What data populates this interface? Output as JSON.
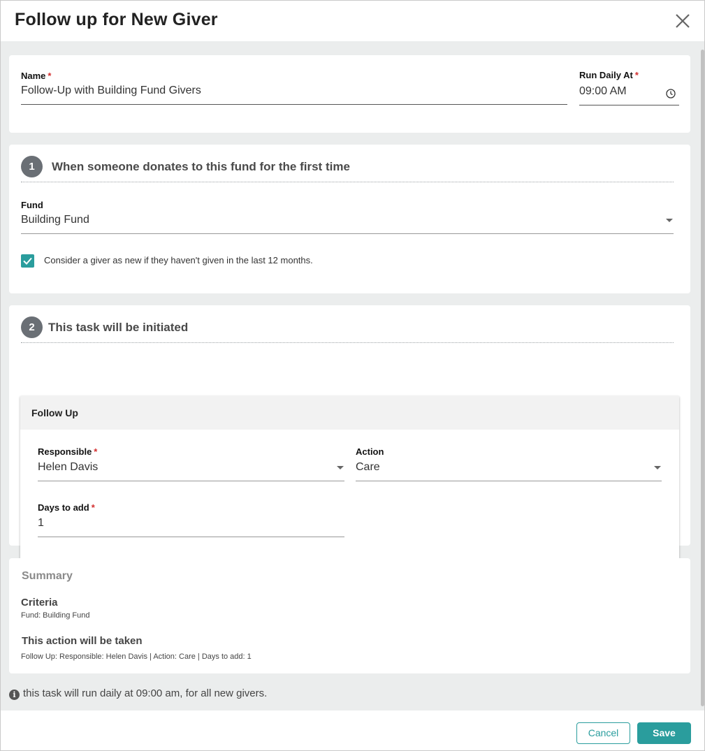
{
  "dialog": {
    "title": "Follow up for New Giver"
  },
  "name_field": {
    "label": "Name",
    "required_mark": "*",
    "value": "Follow-Up with Building Fund Givers"
  },
  "run_daily": {
    "label": "Run Daily At",
    "required_mark": "*",
    "value": "09:00 AM"
  },
  "step1": {
    "number": "1",
    "title": "When someone donates to this fund for the first time",
    "fund_label": "Fund",
    "fund_value": "Building Fund",
    "checkbox_label": "Consider a giver as new if they haven't given in the last 12 months.",
    "checkbox_checked": true
  },
  "step2": {
    "number": "2",
    "title": "This task will be initiated",
    "task_title": "Follow Up",
    "responsible_label": "Responsible",
    "responsible_required": "*",
    "responsible_value": "Helen Davis",
    "action_label": "Action",
    "action_value": "Care",
    "days_label": "Days to add",
    "days_required": "*",
    "days_value": "1"
  },
  "summary": {
    "title": "Summary",
    "criteria_heading": "Criteria",
    "criteria_text": "Fund: Building Fund",
    "action_heading": "This action will be taken",
    "action_text": "Follow Up: Responsible: Helen Davis | Action: Care | Days to add: 1"
  },
  "info": {
    "icon": "info-icon",
    "text": "this task will run daily at 09:00 am, for all new givers."
  },
  "footer": {
    "cancel_label": "Cancel",
    "save_label": "Save"
  },
  "colors": {
    "accent": "#2a9d9d",
    "required": "#d32f2f",
    "body_bg": "#ebeded"
  }
}
